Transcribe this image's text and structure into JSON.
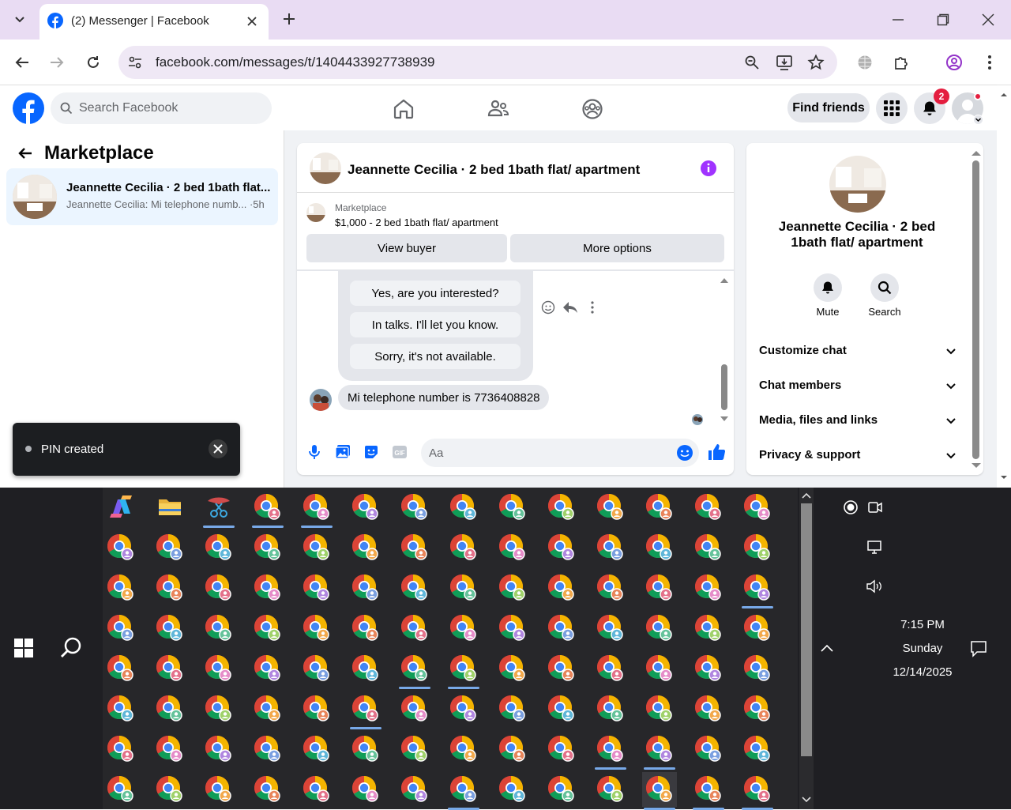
{
  "browser": {
    "tab_title": "(2) Messenger | Facebook",
    "url": "facebook.com/messages/t/1404433927738939"
  },
  "fb": {
    "search_placeholder": "Search Facebook",
    "find_friends": "Find friends",
    "notif_count": "2"
  },
  "left": {
    "title": "Marketplace",
    "conversation": {
      "name": "Jeannette Cecilia · 2 bed 1bath flat...",
      "preview": "Jeannette Cecilia: Mi telephone numb... ·5h"
    }
  },
  "chat": {
    "title": "Jeannette Cecilia · 2 bed 1bath flat/ apartment",
    "listing_source": "Marketplace",
    "listing_price": "$1,000 - 2 bed 1bath flat/ apartment",
    "view_buyer": "View buyer",
    "more_options": "More options",
    "quick_replies": [
      "Yes, are you interested?",
      "In talks. I'll let you know.",
      "Sorry, it's not available."
    ],
    "message": "Mi telephone number is 7736408828",
    "composer_placeholder": "Aa"
  },
  "info": {
    "name": "Jeannette Cecilia · 2 bed 1bath flat/ apartment",
    "mute": "Mute",
    "search": "Search",
    "sections": [
      "Customize chat",
      "Chat members",
      "Media, files and links",
      "Privacy & support"
    ]
  },
  "toast": {
    "text": "PIN created"
  },
  "tray": {
    "time": "7:15 PM",
    "day": "Sunday",
    "date": "12/14/2025"
  },
  "taskbar_badge_colors": [
    "#e3718a",
    "#e58cc8",
    "#b086df",
    "#7a9fe0",
    "#5fb6d9",
    "#64c29a",
    "#9fd16a",
    "#f2a84b",
    "#e8845a"
  ]
}
